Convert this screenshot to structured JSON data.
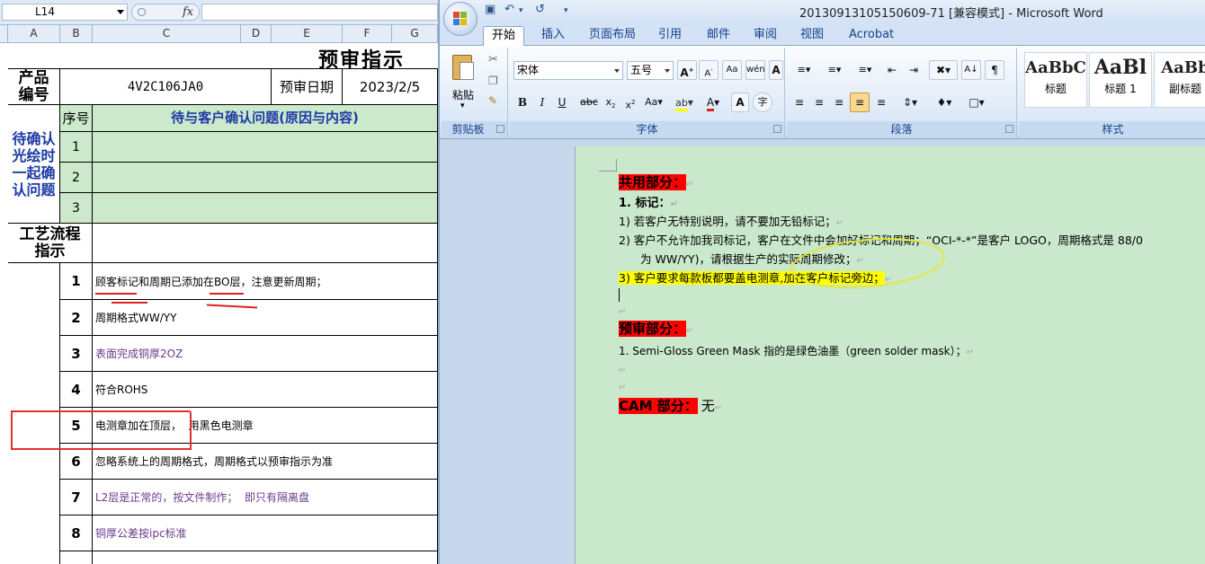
{
  "excel": {
    "name_box": "L14",
    "fx_label": "fx",
    "columns": [
      "A",
      "B",
      "C",
      "D",
      "E",
      "F",
      "G"
    ],
    "title": "预审指示",
    "product_label": "产品\n编号",
    "product_code": "4V2C106JA0",
    "date_label": "预审日期",
    "date_value": "2023/2/5",
    "confirm_label": "待确认\n光绘时\n一起确\n认问题",
    "seq_header": "序号",
    "issue_header": "待与客户确认问题(原因与内容)",
    "confirm_rows": [
      "1",
      "2",
      "3"
    ],
    "process_label": "工艺流程\n指示",
    "process_rows": [
      {
        "no": "1",
        "text": "顾客标记和周期已添加在BO层，注意更新周期；",
        "purple": false
      },
      {
        "no": "2",
        "text": "周期格式WW/YY",
        "purple": false
      },
      {
        "no": "3",
        "text": "表面完成铜厚2OZ",
        "purple": true
      },
      {
        "no": "4",
        "text": "符合ROHS",
        "purple": false
      },
      {
        "no": "5",
        "text": "电测章加在顶层，  用黑色电测章",
        "purple": false
      },
      {
        "no": "6",
        "text": "忽略系统上的周期格式，周期格式以预审指示为准",
        "purple": false
      },
      {
        "no": "7",
        "text": "L2层是正常的，按文件制作；  即只有隔离盘",
        "purple": true
      },
      {
        "no": "8",
        "text": "铜厚公差按ipc标准",
        "purple": true
      }
    ]
  },
  "word": {
    "window_title": "20130913105150609-71 [兼容模式] - Microsoft Word",
    "tabs": [
      "开始",
      "插入",
      "页面布局",
      "引用",
      "邮件",
      "审阅",
      "视图",
      "Acrobat"
    ],
    "active_tab": "开始",
    "clipboard": {
      "paste_label": "粘贴",
      "group_label": "剪贴板"
    },
    "font": {
      "name": "宋体",
      "size": "五号",
      "group_label": "字体"
    },
    "paragraph": {
      "group_label": "段落"
    },
    "styles": {
      "group_label": "样式",
      "items": [
        {
          "sample": "AaBbC",
          "name": "标题"
        },
        {
          "sample": "AaBl",
          "name": "标题 1"
        },
        {
          "sample": "AaBb",
          "name": "副标题"
        }
      ]
    },
    "document": {
      "section1_heading": "共用部分：",
      "item1_heading": "1.   标记：",
      "line1": "1)  若客户无特别说明，请不要加无铅标记；",
      "line2a": "2)  客户不允许加我司标记，客户在文件中会加好标记和周期；“OCI-*-*”是客户 LOGO，周期格式是 88/0",
      "line2b": "为 WW/YY)，请根据生产的实际周期修改；",
      "line3": "3)  客户要求每款板都要盖电测章,加在客户标记旁边；",
      "section2_heading": "预审部分：",
      "section2_line": "1.   Semi-Gloss Green Mask 指的是绿色油墨（green solder mask）；",
      "section3_heading": "CAM 部分：",
      "section3_value": "无"
    }
  },
  "colors": {
    "excel_green": "#cce9cc",
    "excel_blue_text": "#1d3aa6",
    "excel_purple_text": "#6b3a8c",
    "annotation_red": "#e02020",
    "word_page_green": "#c9e8cc",
    "highlight_red": "#ff0000",
    "highlight_yellow": "#ffff00"
  }
}
